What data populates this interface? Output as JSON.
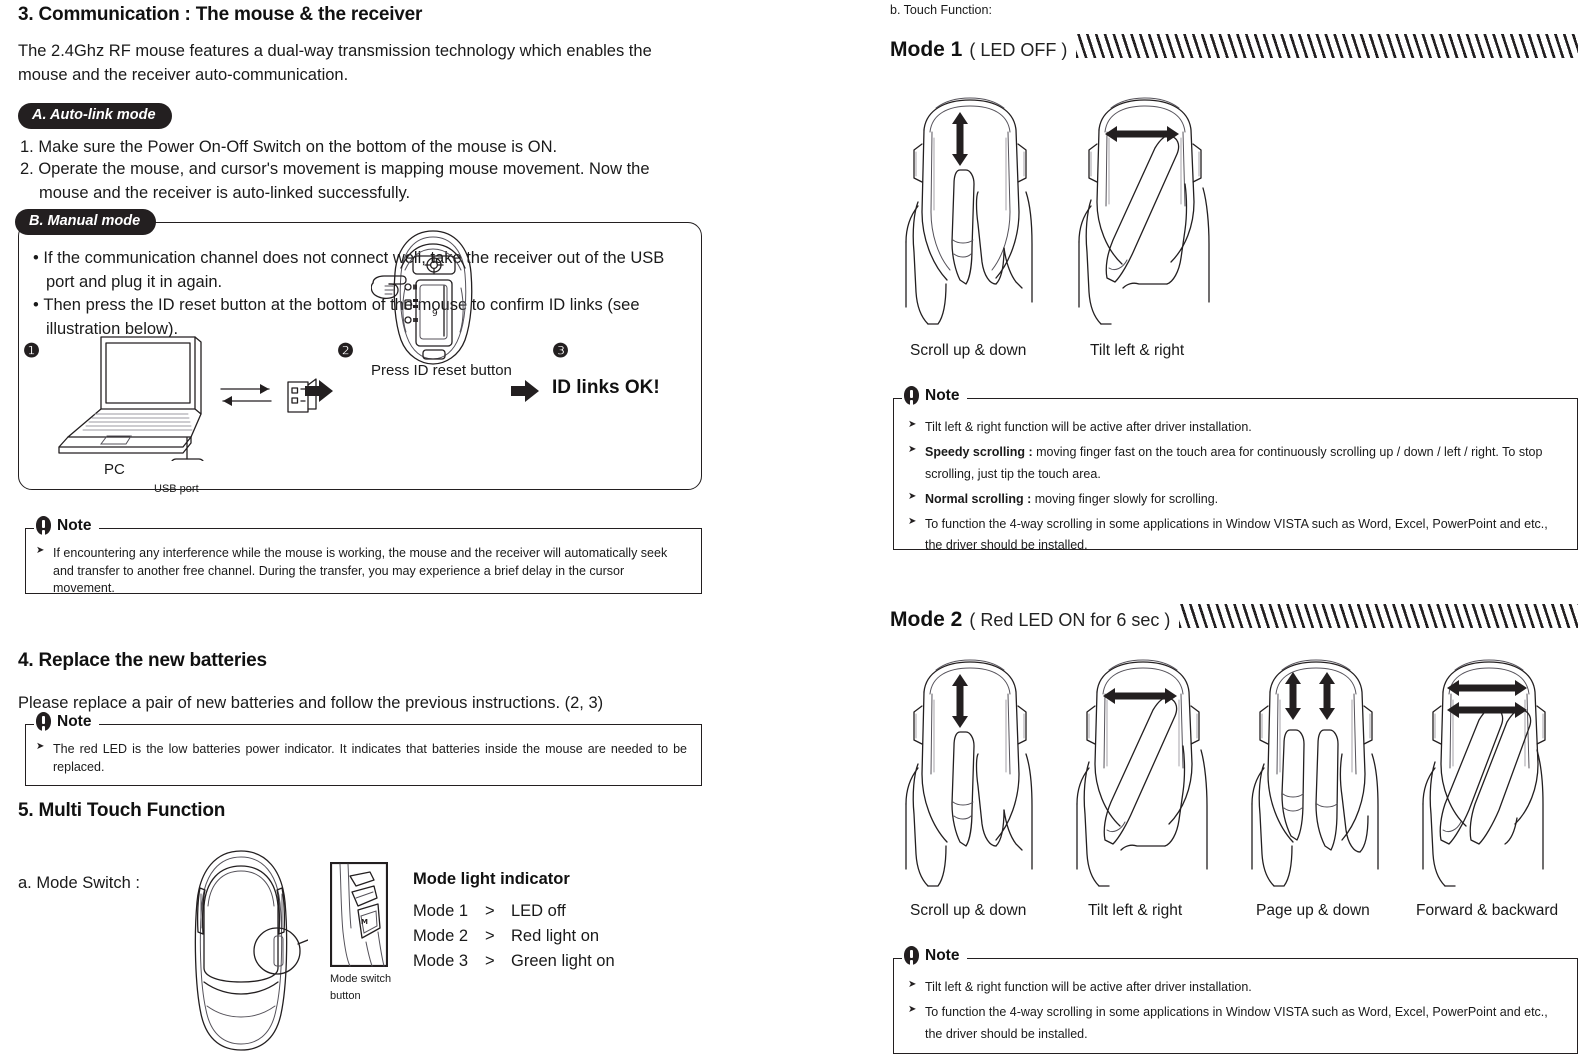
{
  "left": {
    "section3": {
      "heading": "3. Communication : The mouse & the receiver",
      "intro": "The 2.4Ghz RF mouse features a dual-way transmission technology which enables the mouse and the receiver auto-communication.",
      "auto_link": {
        "tag": "A. Auto-link mode",
        "steps": [
          "1. Make sure the Power On-Off Switch on the bottom of the mouse is ON.",
          "2. Operate the mouse, and cursor's movement is mapping mouse movement. Now the mouse and the receiver is auto-linked successfully."
        ]
      },
      "manual": {
        "tag": "B. Manual mode",
        "bullets": [
          "If the communication channel does not connect well, take the receiver out of the USB port and plug it in again.",
          "Then press the ID reset button at the bottom of the mouse to confirm ID links (see illustration below)."
        ],
        "step1_num": "❶",
        "step2_num": "❷",
        "step3_num": "❸",
        "pc_label": "PC",
        "usb_label": "USB port",
        "press_label": "Press ID reset button",
        "ok_label": "ID links OK!"
      },
      "note": {
        "title": "Note",
        "items": [
          "If encountering any interference while the mouse is working, the mouse and the receiver will automatically seek and transfer to another free channel. During the transfer, you may experience a brief delay in the cursor movement."
        ]
      }
    },
    "section4": {
      "heading": "4. Replace the new batteries",
      "body": "Please replace a pair of new batteries and follow the previous instructions. (2, 3)",
      "note": {
        "title": "Note",
        "items": [
          "The red LED is the low batteries power indicator.  It indicates that batteries inside the mouse are needed to be replaced."
        ]
      }
    },
    "section5": {
      "heading": "5. Multi Touch Function",
      "mode_switch_label": "a. Mode Switch :",
      "callout_label_line1": "Mode switch",
      "callout_label_line2": "button",
      "indicator": {
        "title": "Mode light indicator",
        "rows": [
          {
            "mode": "Mode 1",
            "arrow": ">",
            "state": "LED off"
          },
          {
            "mode": "Mode 2",
            "arrow": ">",
            "state": "Red light on"
          },
          {
            "mode": "Mode 3",
            "arrow": ">",
            "state": "Green light on"
          }
        ]
      }
    }
  },
  "right": {
    "touch_function_label": "b. Touch Function:",
    "mode1": {
      "num": "Mode 1",
      "paren": "( LED OFF )",
      "gestures": [
        {
          "label": "Scroll up & down",
          "arrow": "vertical-double-arrow"
        },
        {
          "label": "Tilt left & right",
          "arrow": "horizontal-double-arrow"
        }
      ],
      "note": {
        "title": "Note",
        "items": [
          {
            "bold": "",
            "text": "Tilt left & right function will be active after driver installation."
          },
          {
            "bold": "Speedy scrolling :",
            "text": " moving finger fast on the touch area for continuously scrolling up / down / left / right.  To stop scrolling, just tip the touch area."
          },
          {
            "bold": "Normal scrolling :",
            "text": " moving finger slowly for scrolling."
          },
          {
            "bold": "",
            "text": "To function the 4-way scrolling in some applications in Window VISTA such as Word, Excel, PowerPoint and etc., the driver should be installed."
          }
        ]
      }
    },
    "mode2": {
      "num": "Mode 2",
      "paren": "( Red LED ON for 6 sec )",
      "gestures": [
        {
          "label": "Scroll up & down",
          "arrow": "vertical-double-arrow"
        },
        {
          "label": "Tilt left & right",
          "arrow": "horizontal-double-arrow"
        },
        {
          "label": "Page up & down",
          "arrow": "two-vertical-double-arrows"
        },
        {
          "label": "Forward & backward",
          "arrow": "two-horizontal-double-arrows"
        }
      ],
      "note": {
        "title": "Note",
        "items": [
          {
            "bold": "",
            "text": "Tilt left & right function will be active after driver installation."
          },
          {
            "bold": "",
            "text": "To function the 4-way scrolling in some applications in Window VISTA such as Word, Excel, PowerPoint and etc., the driver should be installed."
          }
        ]
      }
    }
  }
}
